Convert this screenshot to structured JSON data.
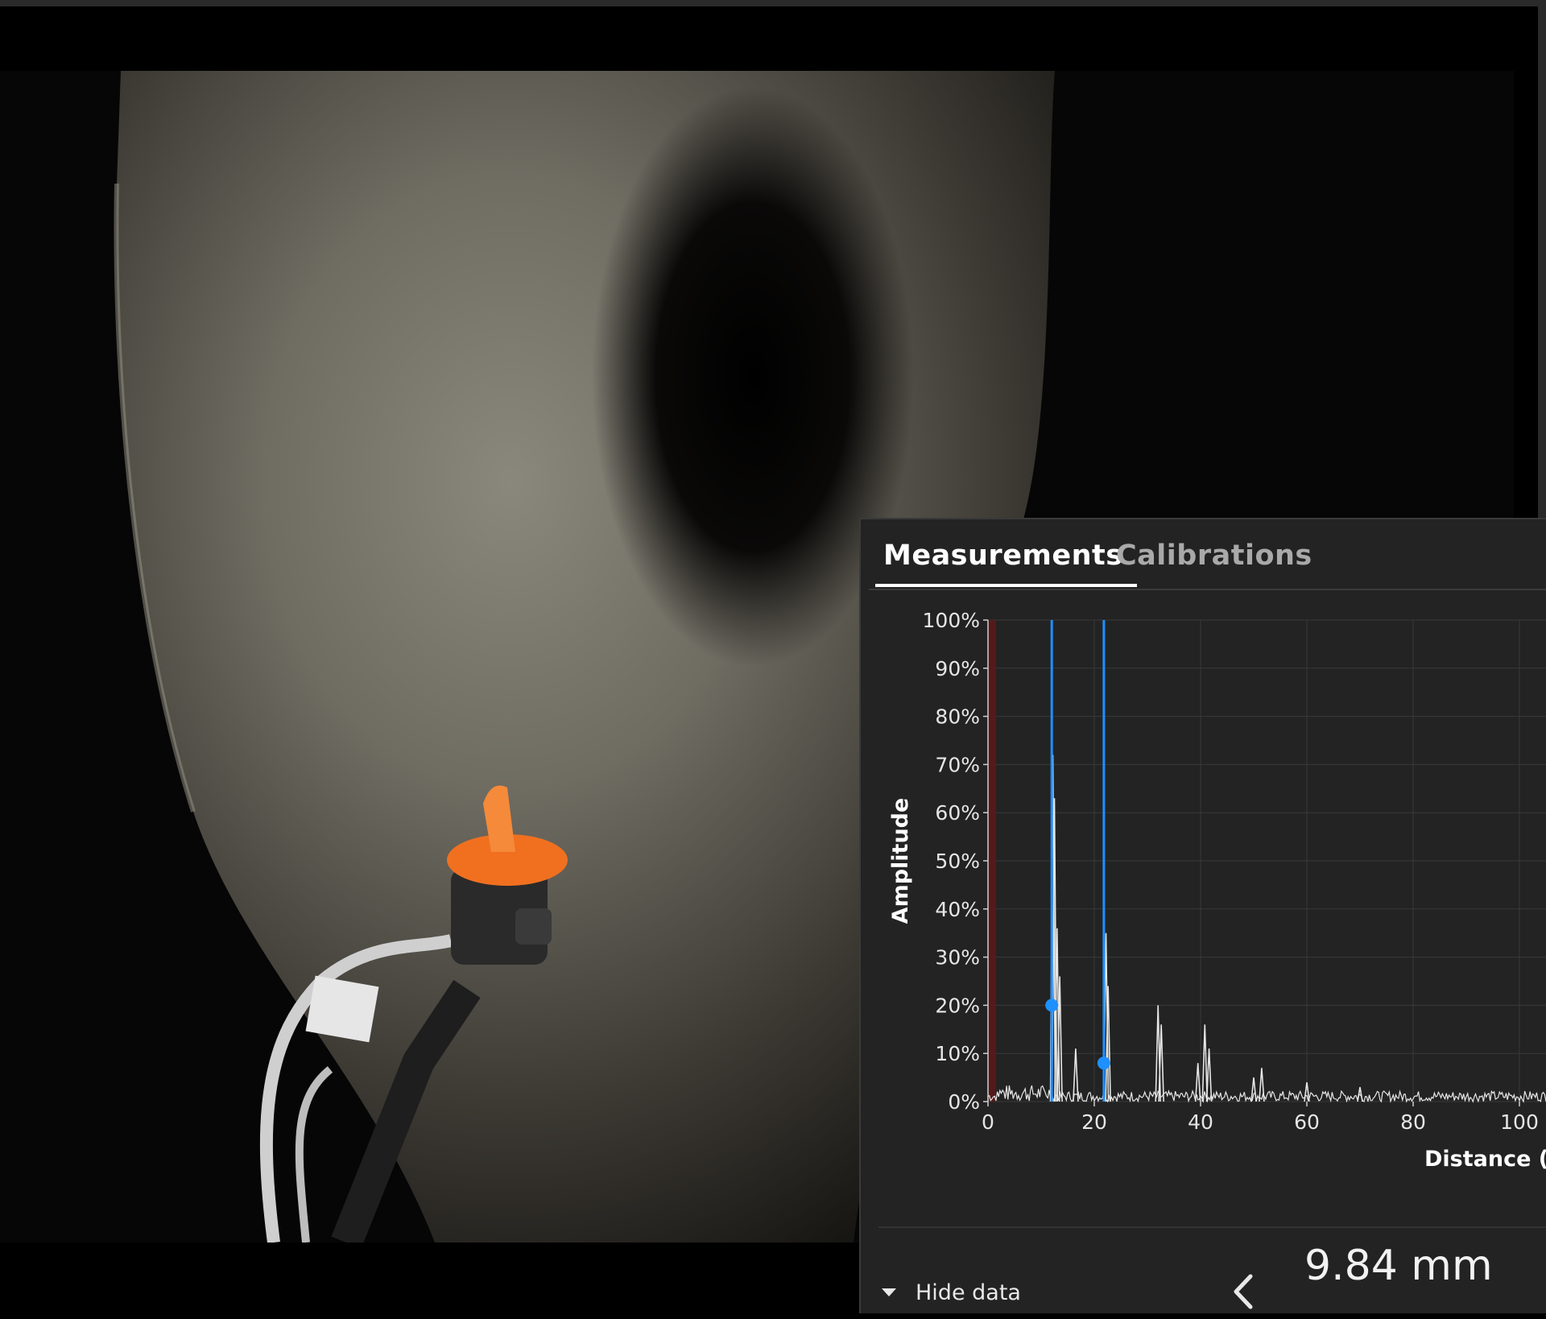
{
  "tabs": [
    {
      "label": "Measurements",
      "active": true
    },
    {
      "label": "Calibrations",
      "active": false
    }
  ],
  "controls": {
    "hide_data_label": "Hide data",
    "caret_icon": "caret-down-icon",
    "prev_icon": "chevron-left-icon"
  },
  "reading": {
    "value": "9.84 mm"
  },
  "colors": {
    "panel_bg": "#232323",
    "accent_blue": "#1e90ff",
    "signal": "#e6e6e6",
    "dead_zone": "#5a1a1a",
    "grid": "#3a3a3a"
  },
  "chart_data": {
    "type": "line",
    "ylabel": "Amplitude",
    "xlabel": "Distance (",
    "y_ticks": [
      "0%",
      "10%",
      "20%",
      "30%",
      "40%",
      "50%",
      "60%",
      "70%",
      "80%",
      "90%",
      "100%"
    ],
    "x_ticks": [
      "0",
      "20",
      "40",
      "60",
      "80",
      "100"
    ],
    "xlim": [
      0,
      105
    ],
    "ylim": [
      0,
      100
    ],
    "grid": true,
    "gates": [
      {
        "x": 12.0,
        "marker_y": 20
      },
      {
        "x": 21.8,
        "marker_y": 8
      }
    ],
    "dead_zone": [
      0,
      1.5
    ],
    "peaks": [
      {
        "x": 12.2,
        "y": 72
      },
      {
        "x": 12.5,
        "y": 63
      },
      {
        "x": 13.0,
        "y": 36
      },
      {
        "x": 13.5,
        "y": 26
      },
      {
        "x": 16.5,
        "y": 11
      },
      {
        "x": 22.2,
        "y": 35
      },
      {
        "x": 22.6,
        "y": 24
      },
      {
        "x": 32.0,
        "y": 20
      },
      {
        "x": 32.6,
        "y": 16
      },
      {
        "x": 39.5,
        "y": 8
      },
      {
        "x": 40.8,
        "y": 16
      },
      {
        "x": 41.6,
        "y": 11
      },
      {
        "x": 50.0,
        "y": 5
      },
      {
        "x": 51.5,
        "y": 7
      },
      {
        "x": 60.0,
        "y": 4
      },
      {
        "x": 70.0,
        "y": 3
      }
    ]
  }
}
